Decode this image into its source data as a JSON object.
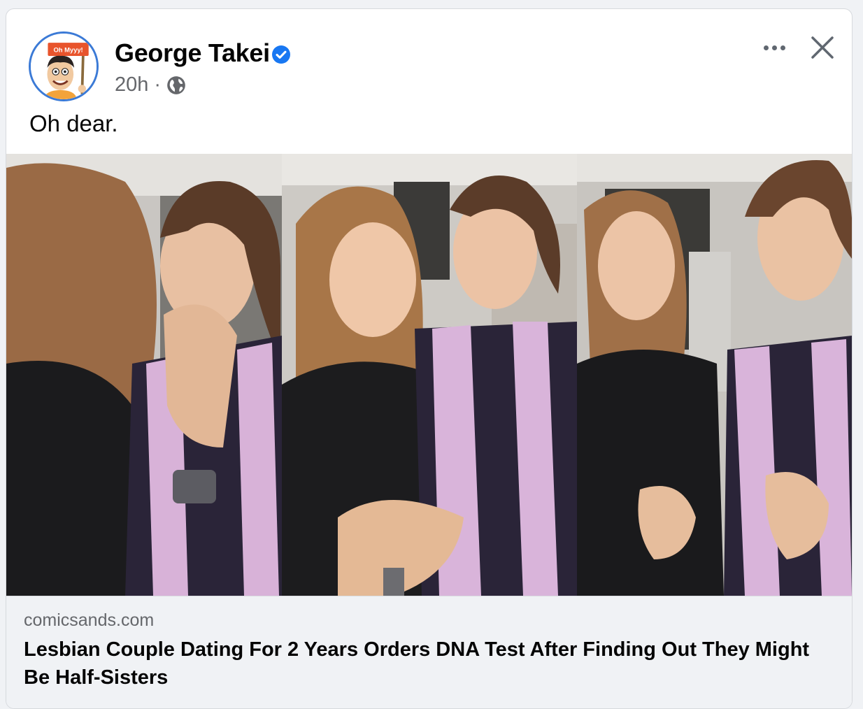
{
  "post": {
    "author": {
      "name": "George Takei",
      "avatar_sign_text": "Oh Myyy!",
      "verified_icon": "verified-badge-icon"
    },
    "timestamp": "20h",
    "separator": "·",
    "audience_icon": "globe-icon",
    "text": "Oh dear."
  },
  "header_actions": {
    "more_icon": "more-options-icon",
    "close_icon": "close-icon"
  },
  "link_preview": {
    "domain": "comicsands.com",
    "headline": "Lesbian Couple Dating For 2 Years Orders DNA Test After Finding Out They Might Be Half-Sisters"
  },
  "colors": {
    "verified_blue": "#1877f2",
    "secondary_text": "#65676b",
    "avatar_ring": "#3b7ad6",
    "avatar_sign": "#e8542c"
  }
}
